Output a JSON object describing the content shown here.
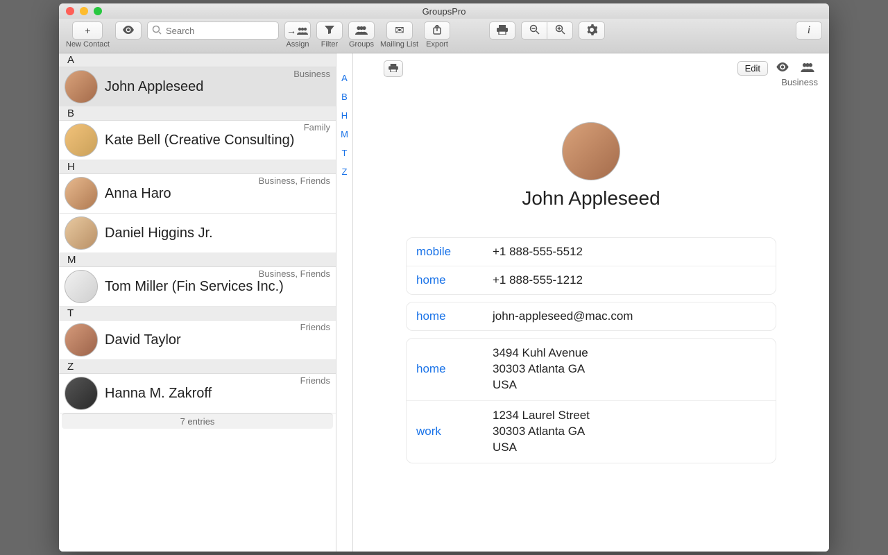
{
  "app_title": "GroupsPro",
  "toolbar": {
    "new_contact_btn": "+",
    "new_contact_label": "New Contact",
    "search_placeholder": "Search",
    "assign_label": "Assign",
    "filter_label": "Filter",
    "groups_label": "Groups",
    "mailing_label": "Mailing List",
    "export_label": "Export"
  },
  "index_letters": [
    "A",
    "B",
    "H",
    "M",
    "T",
    "Z"
  ],
  "sections": [
    {
      "letter": "A",
      "rows": [
        {
          "name": "John Appleseed",
          "groups": "Business",
          "avatar": "av1",
          "selected": true
        }
      ]
    },
    {
      "letter": "B",
      "rows": [
        {
          "name": "Kate Bell (Creative Consulting)",
          "groups": "Family",
          "avatar": "av2"
        }
      ]
    },
    {
      "letter": "H",
      "rows": [
        {
          "name": "Anna Haro",
          "groups": "Business, Friends",
          "avatar": "av3"
        },
        {
          "name": "Daniel Higgins Jr.",
          "groups": "",
          "avatar": "av4"
        }
      ]
    },
    {
      "letter": "M",
      "rows": [
        {
          "name": "Tom Miller (Fin Services Inc.)",
          "groups": "Business, Friends",
          "avatar": "av5"
        }
      ]
    },
    {
      "letter": "T",
      "rows": [
        {
          "name": "David Taylor",
          "groups": "Friends",
          "avatar": "av6"
        }
      ]
    },
    {
      "letter": "Z",
      "rows": [
        {
          "name": "Hanna M. Zakroff",
          "groups": "Friends",
          "avatar": "av7"
        }
      ]
    }
  ],
  "footer_text": "7 entries",
  "detail": {
    "edit_label": "Edit",
    "business_label": "Business",
    "name": "John Appleseed",
    "phones": [
      {
        "label": "mobile",
        "value": "+1 888-555-5512"
      },
      {
        "label": "home",
        "value": "+1 888-555-1212"
      }
    ],
    "emails": [
      {
        "label": "home",
        "value": "john-appleseed@mac.com"
      }
    ],
    "addresses": [
      {
        "label": "home",
        "lines": [
          "3494 Kuhl Avenue",
          "30303 Atlanta GA",
          "USA"
        ]
      },
      {
        "label": "work",
        "lines": [
          "1234 Laurel Street",
          "30303 Atlanta GA",
          "USA"
        ]
      }
    ]
  }
}
